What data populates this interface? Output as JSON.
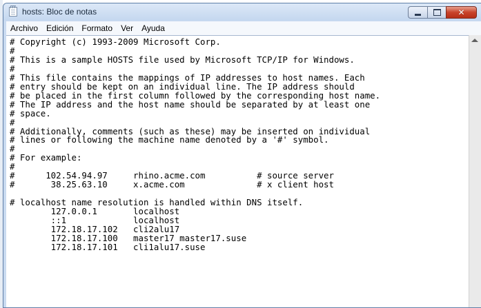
{
  "window": {
    "title": "hosts: Bloc de notas"
  },
  "menu": {
    "items": [
      "Archivo",
      "Edición",
      "Formato",
      "Ver",
      "Ayuda"
    ]
  },
  "editor": {
    "lines": [
      "# Copyright (c) 1993-2009 Microsoft Corp.",
      "#",
      "# This is a sample HOSTS file used by Microsoft TCP/IP for Windows.",
      "#",
      "# This file contains the mappings of IP addresses to host names. Each",
      "# entry should be kept on an individual line. The IP address should",
      "# be placed in the first column followed by the corresponding host name.",
      "# The IP address and the host name should be separated by at least one",
      "# space.",
      "#",
      "# Additionally, comments (such as these) may be inserted on individual",
      "# lines or following the machine name denoted by a '#' symbol.",
      "#",
      "# For example:",
      "#",
      "#      102.54.94.97     rhino.acme.com          # source server",
      "#       38.25.63.10     x.acme.com              # x client host",
      "",
      "# localhost name resolution is handled within DNS itself.",
      "        127.0.0.1       localhost",
      "        ::1             localhost",
      "        172.18.17.102   cli2alu17",
      "        172.18.17.100   master17 master17.suse",
      "        172.18.17.101   cli1alu17.suse"
    ]
  },
  "icons": {
    "app": "notepad-icon",
    "minimize": "minimize-icon",
    "maximize": "maximize-icon",
    "close": "close-icon"
  },
  "colors": {
    "title_bar": "#c4d7ef",
    "close_button": "#c8432a",
    "editor_background": "#ffffff"
  }
}
